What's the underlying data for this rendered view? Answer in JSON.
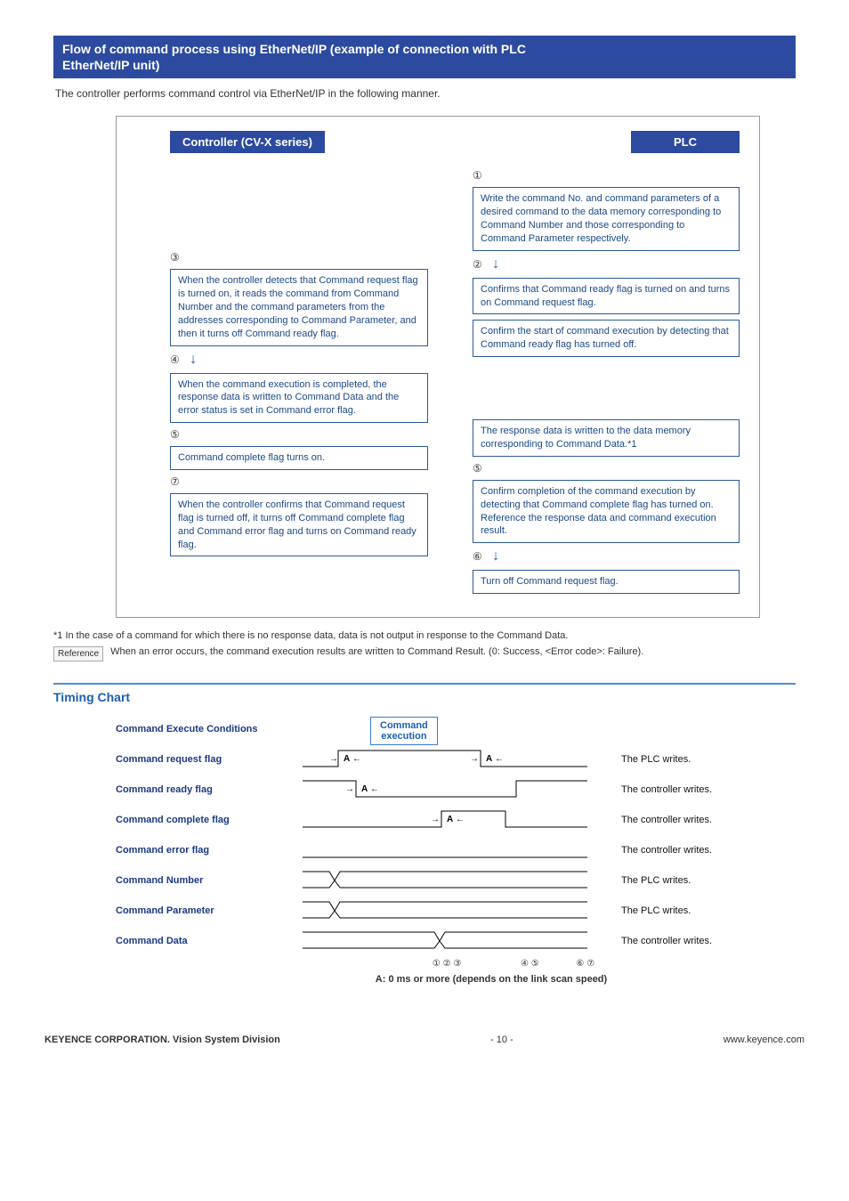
{
  "header": {
    "title_line1": "Flow of command process using EtherNet/IP (example of connection with PLC",
    "title_line2": "EtherNet/IP unit)"
  },
  "intro": "The controller performs command control via EtherNet/IP in the following manner.",
  "flow": {
    "controller_label": "Controller (CV-X series)",
    "plc_label": "PLC",
    "step1_num": "①",
    "step1": "Write the command No. and command parameters of a desired command to the data memory corresponding to Command Number and those corresponding to Command Parameter respectively.",
    "step2_num": "②",
    "step2": "Confirms that Command ready flag is turned on and turns on Command request flag.",
    "step2b": "Confirm the start of command execution by detecting that Command ready flag has turned off.",
    "step3_num": "③",
    "step3": "When the controller detects that Command request flag is turned on, it reads the command from Command Number and the command parameters from the addresses corresponding to Command Parameter, and then it turns off Command ready flag.",
    "step4_num": "④",
    "step4": "When the command execution is completed, the response data is written to Command Data and the error status is set in Command error flag.",
    "step4r": "The response data is written to the data memory corresponding to Command Data.*1",
    "step5_num_l": "⑤",
    "step5_l": "Command complete flag turns on.",
    "step5_num_r": "⑤",
    "step5_r": "Confirm completion of the command execution by detecting that Command complete flag has turned on. Reference the response data and command execution result.",
    "step6_num": "⑥",
    "step6": "Turn off Command request flag.",
    "step7_num": "⑦",
    "step7": "When the controller confirms that Command request flag is turned off, it turns off Command complete flag and Command error flag and turns on Command ready flag."
  },
  "footnote": "*1 In the case of a command for which there is no response data, data is not output in response to the Command Data.",
  "ref_label": "Reference",
  "ref_text": "When an error occurs, the command execution results are written to Command Result. (0: Success, <Error code>: Failure).",
  "timing": {
    "title": "Timing Chart",
    "rows": {
      "r0": "Command Execute Conditions",
      "exec_box": "Command\nexecution",
      "r1": "Command request flag",
      "r2": "Command ready flag",
      "r3": "Command complete flag",
      "r4": "Command error flag",
      "r5": "Command Number",
      "r6": "Command Parameter",
      "r7": "Command Data"
    },
    "side": {
      "s1": "The PLC writes.",
      "s2": "The controller writes.",
      "s3": "The controller writes.",
      "s4": "The controller writes.",
      "s5": "The PLC writes.",
      "s6": "The PLC writes.",
      "s7": "The controller writes."
    },
    "markers": "① ② ③                        ④ ⑤               ⑥ ⑦",
    "caption": "A: 0 ms or more (depends on the link scan speed)"
  },
  "footer": {
    "left": "KEYENCE CORPORATION. Vision System Division",
    "center": "- 10 -",
    "right": "www.keyence.com"
  }
}
